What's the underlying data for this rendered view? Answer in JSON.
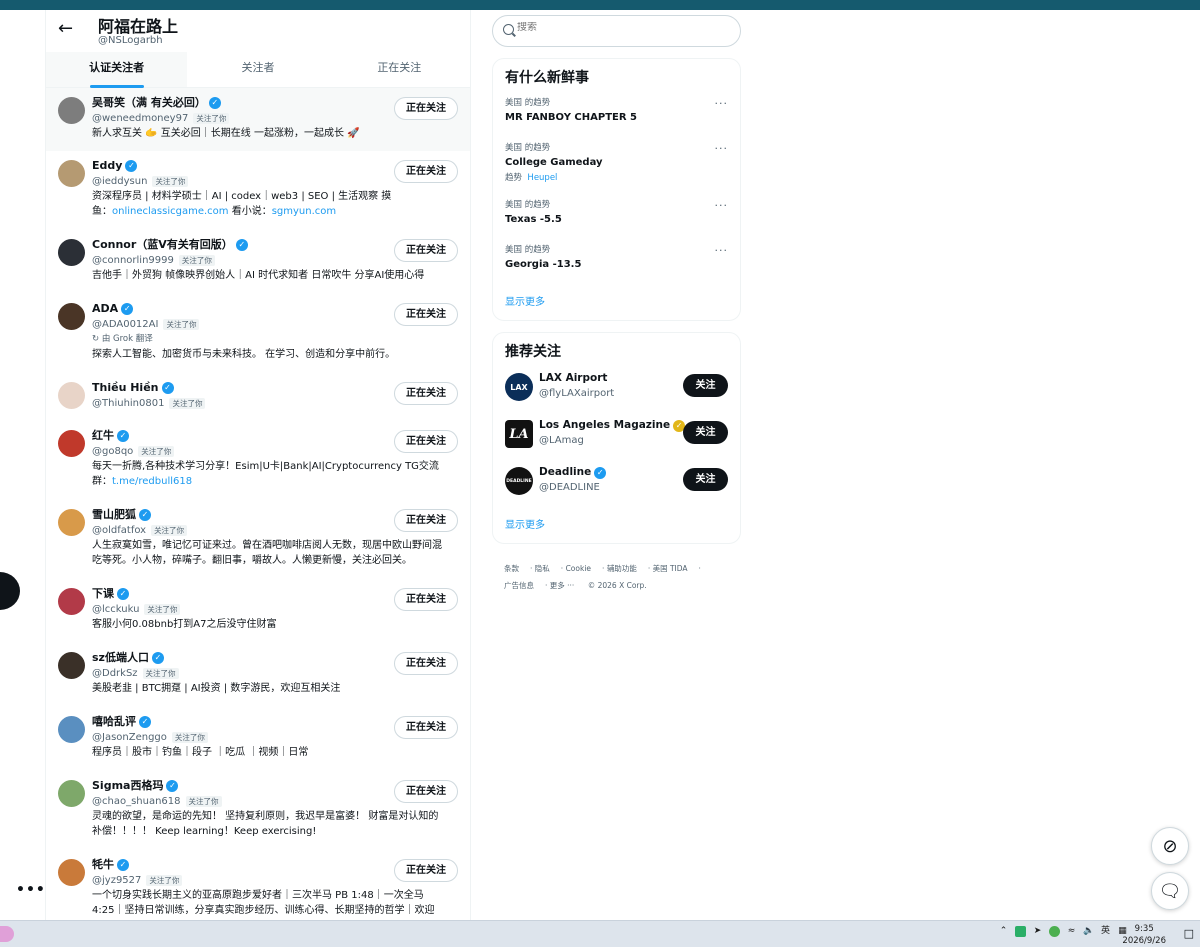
{
  "header": {
    "title": "阿福在路上",
    "handle": "@NSLogarbh"
  },
  "tabs": [
    {
      "label": "认证关注者"
    },
    {
      "label": "关注者"
    },
    {
      "label": "正在关注"
    }
  ],
  "follows_you_label": "关注了你",
  "following_label": "正在关注",
  "users": [
    {
      "name": "吴哥笑（满 有关必回）",
      "handle": "@weneedmoney97",
      "bio": "新人求互关 🫱 互关必回｜长期在线 一起涨粉，一起成长 🚀"
    },
    {
      "name": "Eddy",
      "handle": "@ieddysun",
      "bio_1": "资深程序员 | 材料学硕士｜AI | codex｜web3 | SEO | 生活观察 摸",
      "bio_2a": "鱼：",
      "bio_link_1": "onlineclassicgame.com",
      "bio_2b": " 看小说：",
      "bio_link_2": "sgmyun.com"
    },
    {
      "name": "Connor（蓝V有关有回版）",
      "handle": "@connorlin9999",
      "bio": "吉他手｜外贸狗 帧像映界创始人｜AI 时代求知者 日常吹牛 分享AI使用心得"
    },
    {
      "name": "ADA",
      "handle": "@ADA0012AI",
      "grok": "由 Grok 翻译",
      "bio": "探索人工智能、加密货币与未来科技。 在学习、创造和分享中前行。"
    },
    {
      "name": "Thiều Hiền",
      "handle": "@Thiuhin0801"
    },
    {
      "name": "红牛",
      "handle": "@go8qo",
      "bio_1": "每天一折腾,各种技术学习分享！Esim|U卡|Bank|AI|Cryptocurrency TG交流",
      "bio_2a": "群：",
      "bio_link_1": "t.me/redbull618"
    },
    {
      "name": "雪山肥狐",
      "handle": "@oldfatfox",
      "bio": "人生寂寞如雪，唯记忆可证来过。曾在酒吧咖啡店阅人无数，现居中欧山野间混吃等死。小人物，碎嘴子。翻旧事，嚼故人。人懒更新慢，关注必回关。"
    },
    {
      "name": "下课",
      "handle": "@lcckuku",
      "bio": "客服小何0.08bnb打到A7之后没守住财富"
    },
    {
      "name": "sz低端人口",
      "handle": "@DdrkSz",
      "bio": "美股老韭 | BTC拥趸 | AI投资 | 数字游民，欢迎互相关注"
    },
    {
      "name": "嘻哈乱评",
      "handle": "@JasonZenggo",
      "bio": "程序员｜股市｜钓鱼｜段子 ｜吃瓜 ｜视频｜日常"
    },
    {
      "name": "Sigma西格玛",
      "handle": "@chao_shuan618",
      "bio": "灵魂的欲望，是命运的先知！ 坚持复利原则，我迟早是富婆！ 财富是对认知的补偿！！！！ Keep learning！Keep exercising!"
    },
    {
      "name": "牦牛",
      "handle": "@jyz9527",
      "bio": "一个切身实践长期主义的亚高原跑步爱好者｜三次半马 PB 1:48｜一次全马 4:25｜坚持日常训练，分享真实跑步经历、训练心得、长期坚持的哲学｜欢迎"
    }
  ],
  "search": {
    "placeholder": "搜索"
  },
  "trends": {
    "title": "有什么新鲜事",
    "items": [
      {
        "meta": "美国 的趋势",
        "name": "MR FANBOY CHAPTER 5"
      },
      {
        "meta": "美国 的趋势",
        "name": "College Gameday",
        "sub_label": "趋势",
        "sub_value": "Heupel"
      },
      {
        "meta": "美国 的趋势",
        "name": "Texas -5.5"
      },
      {
        "meta": "美国 的趋势",
        "name": "Georgia -13.5"
      }
    ],
    "show_more": "显示更多"
  },
  "recommend": {
    "title": "推荐关注",
    "follow_label": "关注",
    "items": [
      {
        "name": "LAX Airport",
        "handle": "@flyLAXairport",
        "avatar_text": "LAX"
      },
      {
        "name": "Los Angeles Magazine",
        "handle": "@LAmag",
        "avatar_text": "LA"
      },
      {
        "name": "Deadline",
        "handle": "@DEADLINE",
        "avatar_text": "DEADLINE"
      }
    ],
    "show_more": "显示更多"
  },
  "footer": {
    "links": [
      "条款",
      "隐私",
      "Cookie",
      "辅助功能",
      "美国 TIDA",
      "广告信息",
      "更多 ···",
      "© 2026 X Corp."
    ]
  },
  "taskbar": {
    "ime": "英",
    "time": "9:35",
    "date": "2026/9/26"
  },
  "colors": {
    "accent": "#1d9bf0",
    "text": "#0f1419",
    "muted": "#536471",
    "gold": "#e2b719"
  }
}
